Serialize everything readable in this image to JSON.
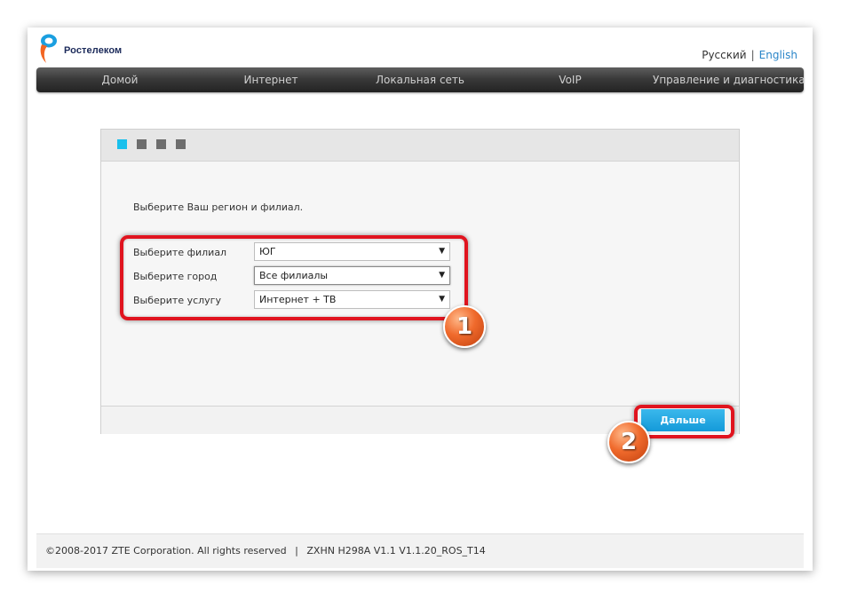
{
  "header": {
    "brand": "Ростелеком",
    "language": {
      "ru": "Русский",
      "separator": "|",
      "en": "English"
    }
  },
  "nav": {
    "items": [
      {
        "label": "Домой"
      },
      {
        "label": "Интернет"
      },
      {
        "label": "Локальная сеть"
      },
      {
        "label": "VoIP"
      },
      {
        "label": "Управление и диагностика"
      }
    ]
  },
  "wizard": {
    "steps_total": 4,
    "active_step": 1,
    "intro": "Выберите Ваш регион и филиал.",
    "fields": [
      {
        "label": "Выберите филиал",
        "value": "ЮГ"
      },
      {
        "label": "Выберите город",
        "value": "Все филиалы"
      },
      {
        "label": "Выберите услугу",
        "value": "Интернет + ТВ"
      }
    ],
    "next_label": "Дальше"
  },
  "annotations": {
    "badge1": "1",
    "badge2": "2",
    "highlight_color": "#e0141f"
  },
  "footer": {
    "copyright": "©2008-2017 ZTE Corporation. All rights reserved",
    "separator": "|",
    "version": "ZXHN H298A V1.1 V1.1.20_ROS_T14"
  },
  "colors": {
    "accent": "#19c0ec",
    "button": "#149ad9",
    "link": "#2a85c8"
  }
}
